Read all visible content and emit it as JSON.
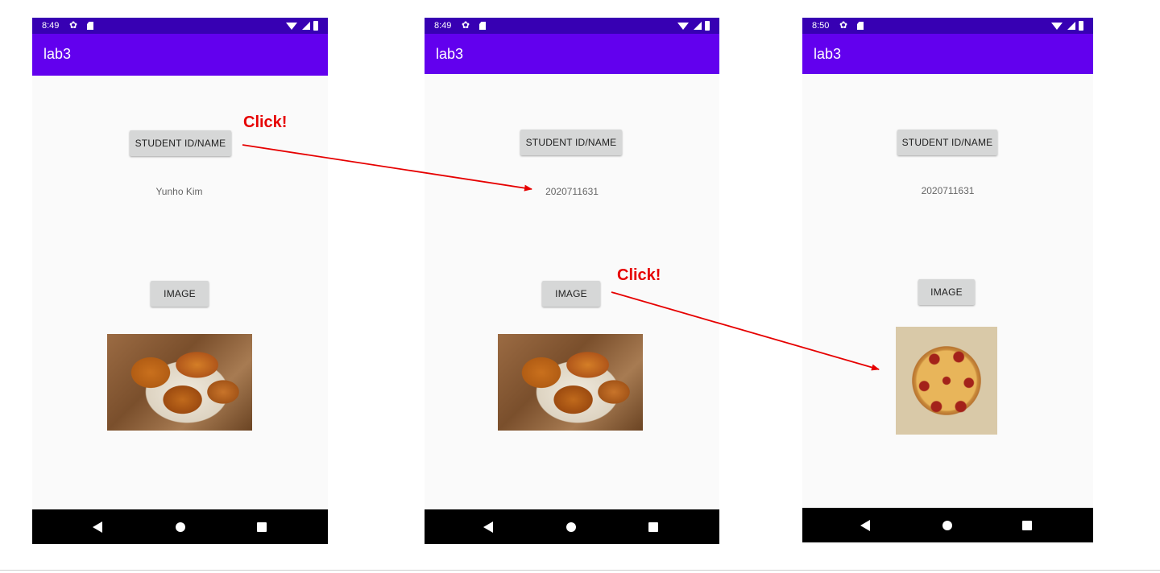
{
  "screens": [
    {
      "status_time": "8:49",
      "app_title": "lab3",
      "student_button": "STUDENT ID/NAME",
      "info_text": "Yunho Kim",
      "image_button": "IMAGE",
      "image": "fried-chicken"
    },
    {
      "status_time": "8:49",
      "app_title": "lab3",
      "student_button": "STUDENT ID/NAME",
      "info_text": "2020711631",
      "image_button": "IMAGE",
      "image": "fried-chicken"
    },
    {
      "status_time": "8:50",
      "app_title": "lab3",
      "student_button": "STUDENT ID/NAME",
      "info_text": "2020711631",
      "image_button": "IMAGE",
      "image": "pepperoni-pizza"
    }
  ],
  "annotations": {
    "click_1": "Click!",
    "click_2": "Click!"
  },
  "colors": {
    "status_bar": "#3700b3",
    "app_bar": "#6200ee",
    "annotation": "#e60000"
  }
}
